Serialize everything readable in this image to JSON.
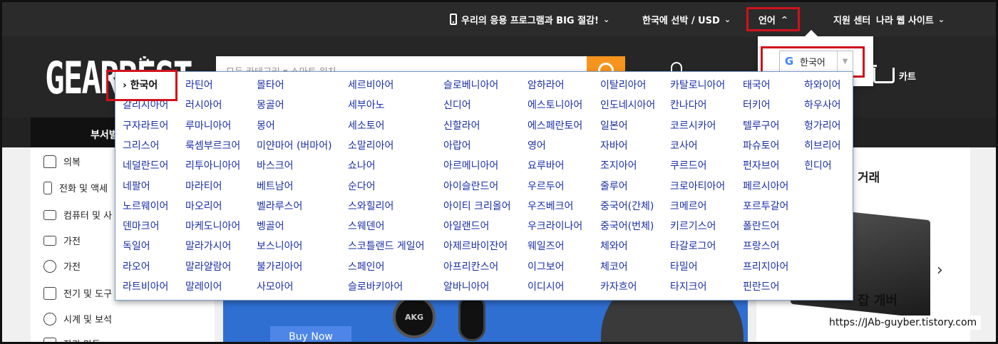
{
  "topbar": {
    "app_promo": "우리의 응용 프로그램과 BIG 절감!",
    "region_currency": "한국에 선박 / USD",
    "language": "언어",
    "support": "지원 센터",
    "country_site": "나라 웹 사이트"
  },
  "header": {
    "logo_text": "GEARBEST",
    "search_placeholder": "모든 카테고리  ▾     스마트 워치",
    "cart_label": "카트"
  },
  "nav": {
    "category_label": "부서별"
  },
  "sidebar": {
    "items": [
      "의복",
      "전화 및 액세",
      "컴퓨터 및 사",
      "가전",
      "가전",
      "전기 및 도구",
      "시계 및 보석",
      "자가 만들"
    ]
  },
  "banner": {
    "buy_now_label": "Buy Now",
    "headphone_brand": "AKG"
  },
  "deal": {
    "title": "거래"
  },
  "watermark": {
    "label": "잡  개버",
    "url": "https://JAb-guyber.tistory.com"
  },
  "lang_selector": {
    "selected": "한국어",
    "icon": "google-g-icon"
  },
  "lang_list": {
    "columns": [
      [
        "› 한국어",
        "갈리시아어",
        "구자라트어",
        "그리스어",
        "네덜란드어",
        "네팔어",
        "노르웨이어",
        "덴마크어",
        "독일어",
        "라오어",
        "라트비아어"
      ],
      [
        "라틴어",
        "러시아어",
        "루마니아어",
        "룩셈부르크어",
        "리투아니아어",
        "마라티어",
        "마오리어",
        "마케도니아어",
        "말라가시어",
        "말라얄람어",
        "말레이어"
      ],
      [
        "몰타어",
        "몽골어",
        "몽어",
        "미얀마어 (버마어)",
        "바스크어",
        "베트남어",
        "벨라루스어",
        "벵골어",
        "보스니아어",
        "불가리아어",
        "사모아어"
      ],
      [
        "세르비아어",
        "세부아노",
        "세소토어",
        "소말리아어",
        "쇼나어",
        "순다어",
        "스와힐리어",
        "스웨덴어",
        "스코틀랜드 게일어",
        "스페인어",
        "슬로바키아어"
      ],
      [
        "슬로베니아어",
        "신디어",
        "신할라어",
        "아랍어",
        "아르메니아어",
        "아이슬란드어",
        "아이티 크리올어",
        "아일랜드어",
        "아제르바이잔어",
        "아프리칸스어",
        "알바니아어"
      ],
      [
        "암하라어",
        "에스토니아어",
        "에스페란토어",
        "영어",
        "요루바어",
        "우르두어",
        "우즈베크어",
        "우크라이나어",
        "웨일즈어",
        "이그보어",
        "이디시어"
      ],
      [
        "이탈리아어",
        "인도네시아어",
        "일본어",
        "자바어",
        "조지아어",
        "줄루어",
        "중국어(간체)",
        "중국어(번체)",
        "체와어",
        "체코어",
        "카자흐어"
      ],
      [
        "카탈로니아어",
        "칸나다어",
        "코르시카어",
        "코사어",
        "쿠르드어",
        "크로아티아어",
        "크메르어",
        "키르기스어",
        "타갈로그어",
        "타밀어",
        "타지크어"
      ],
      [
        "태국어",
        "터키어",
        "텔루구어",
        "파슈토어",
        "펀자브어",
        "페르시아어",
        "포르투갈어",
        "폴란드어",
        "프랑스어",
        "프리지아어",
        "핀란드어"
      ],
      [
        "하와이어",
        "하우사어",
        "헝가리어",
        "히브리어",
        "힌디어"
      ]
    ]
  }
}
